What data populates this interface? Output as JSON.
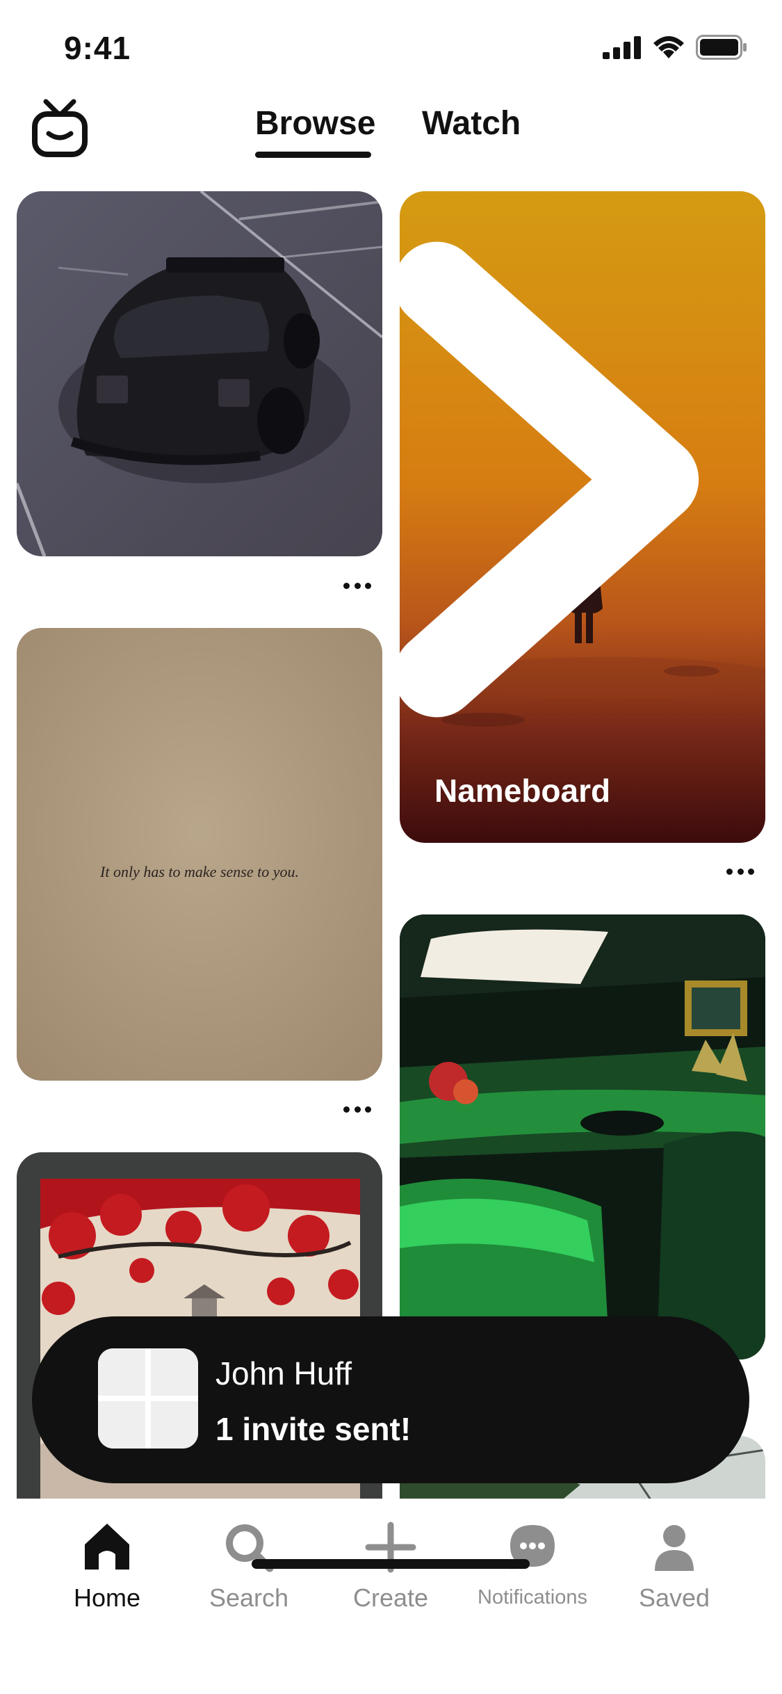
{
  "status_bar": {
    "time": "9:41",
    "icons": [
      "signal-icon",
      "wifi-icon",
      "battery-icon"
    ]
  },
  "header": {
    "logo_icon": "tv-logo-icon",
    "tabs": [
      {
        "label": "Browse",
        "active": true
      },
      {
        "label": "Watch",
        "active": false
      }
    ]
  },
  "feed": {
    "pins": [
      {
        "id": "car",
        "image": "black sports car in parking lot",
        "has_more_menu": true
      },
      {
        "id": "quote",
        "image": "paper with quote",
        "quote": "It only has to make sense to you.",
        "has_more_menu": true
      },
      {
        "id": "tree",
        "image": "red tree illustration"
      },
      {
        "id": "orange",
        "image": "figure in orange haze",
        "board_label": "Nameboard",
        "has_more_menu": true
      },
      {
        "id": "lounge",
        "image": "green lit lounge"
      },
      {
        "id": "glass",
        "image": "glass roof and plants"
      }
    ]
  },
  "toast": {
    "name": "John Huff",
    "message": "1 invite sent!"
  },
  "bottom_nav": {
    "items": [
      {
        "label": "Home",
        "icon": "home-icon",
        "active": true
      },
      {
        "label": "Search",
        "icon": "search-icon",
        "active": false
      },
      {
        "label": "Create",
        "icon": "plus-icon",
        "active": false
      },
      {
        "label": "Notifications",
        "icon": "chat-bubble-icon",
        "active": false
      },
      {
        "label": "Saved",
        "icon": "person-icon",
        "active": false
      }
    ]
  },
  "colors": {
    "text": "#111111",
    "muted": "#8e8e8e",
    "toast_bg": "#111111",
    "background": "#ffffff"
  }
}
